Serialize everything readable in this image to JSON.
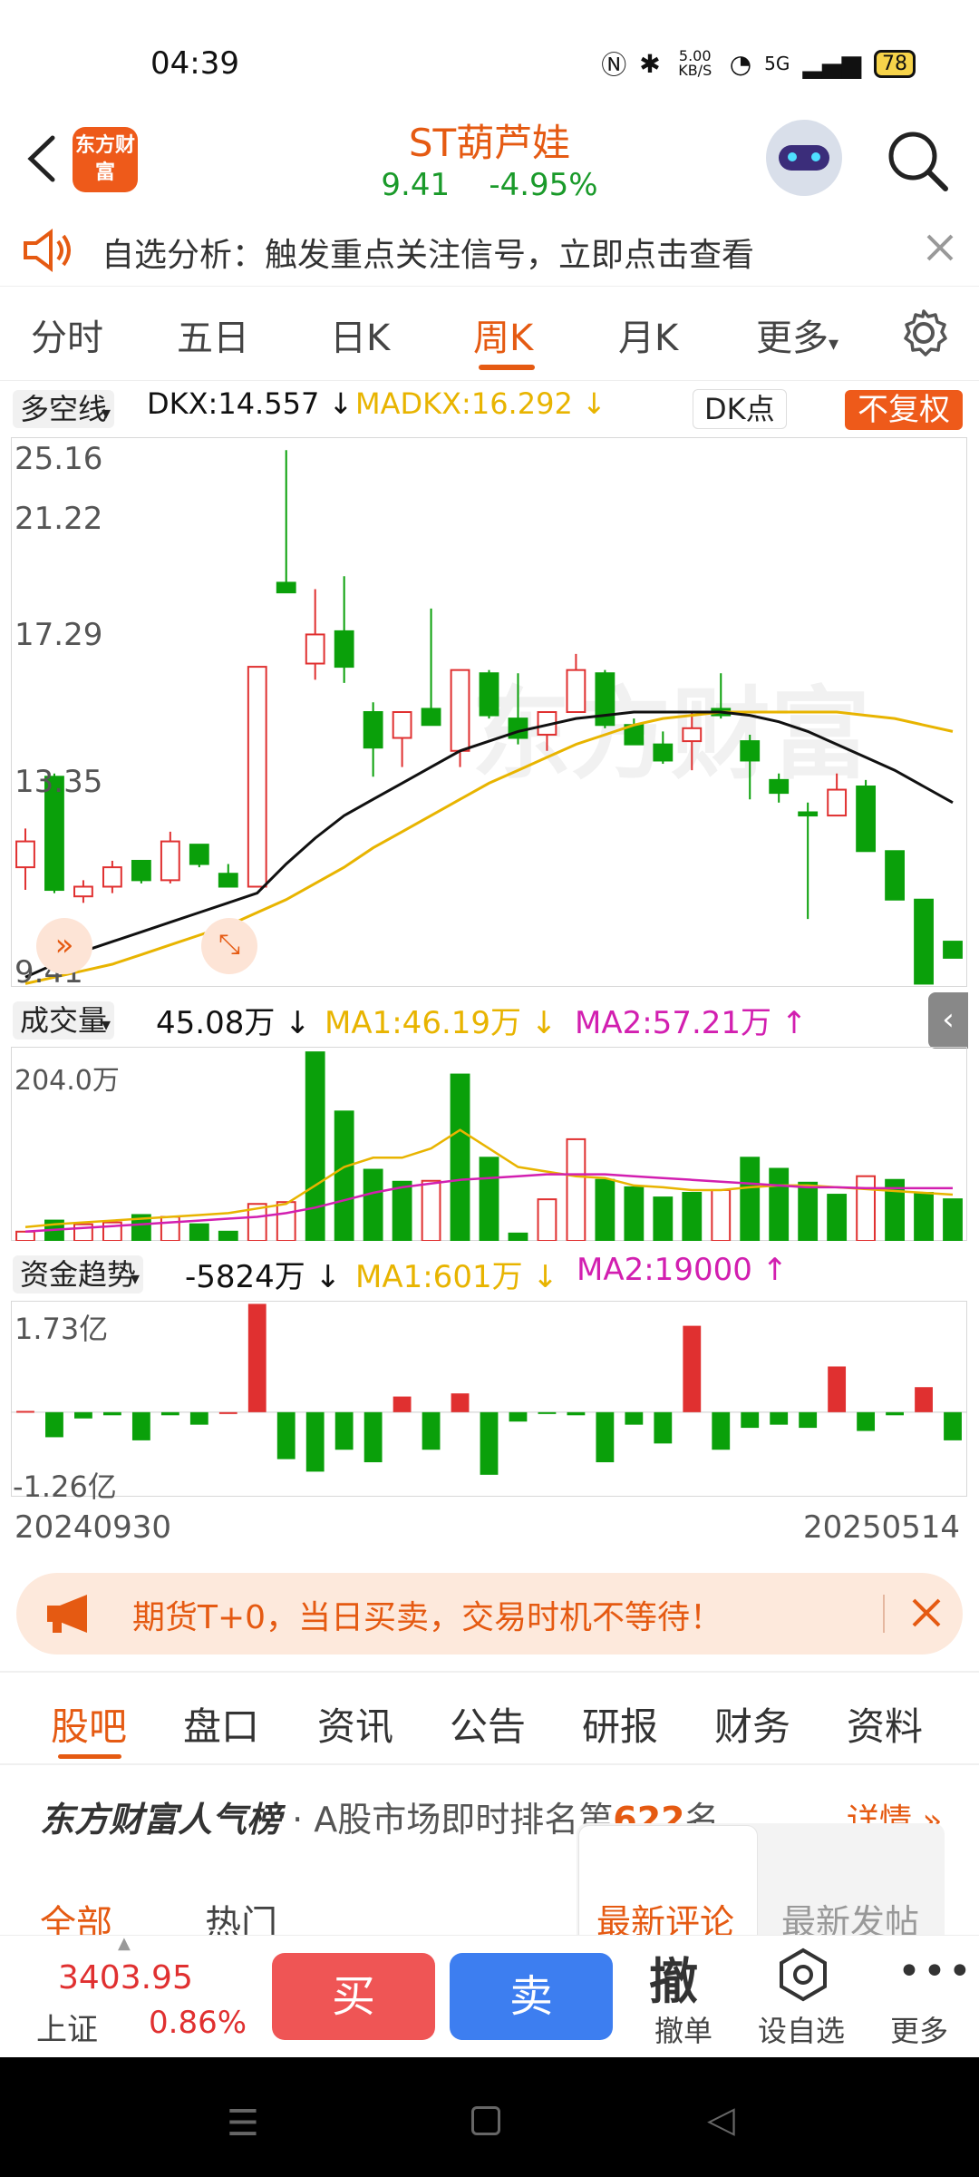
{
  "status_bar": {
    "time": "04:39",
    "net_speed": "5.00 KB/S",
    "signal": "5G",
    "battery": "78"
  },
  "header": {
    "logo": "东方财富",
    "title": "ST葫芦娃",
    "price": "9.41",
    "change": "-4.95%"
  },
  "notice": {
    "text": "自选分析：触发重点关注信号，立即点击查看"
  },
  "tabs": [
    "分时",
    "五日",
    "日K",
    "周K",
    "月K",
    "更多"
  ],
  "active_tab": "周K",
  "indicator": {
    "name": "多空线",
    "dkx": "DKX:14.557",
    "madkx": "MADKX:16.292",
    "dk_btn": "DK点",
    "adjust": "不复权"
  },
  "price_axis": [
    "25.16",
    "21.22",
    "17.29",
    "13.35",
    "9.41"
  ],
  "volume": {
    "name": "成交量",
    "value": "45.08万",
    "ma1": "MA1:46.19万",
    "ma2": "MA2:57.21万",
    "max": "204.0万"
  },
  "fund": {
    "name": "资金趋势",
    "value": "-5824万",
    "ma1": "MA1:601万",
    "ma2": "MA2:19000",
    "max": "1.73亿",
    "min": "-1.26亿"
  },
  "dates": {
    "start": "20240930",
    "end": "20250514"
  },
  "ad": {
    "text": "期货T+0，当日买卖，交易时机不等待！"
  },
  "bottom_tabs": [
    "股吧",
    "盘口",
    "资讯",
    "公告",
    "研报",
    "财务",
    "资料"
  ],
  "rank": {
    "brand": "东方财富人气榜",
    "text": "· A股市场即时排名第",
    "num": "622",
    "suffix": "名",
    "more": "详情"
  },
  "sub_tabs": {
    "all": "全部",
    "hot": "热门",
    "latest_comment": "最新评论",
    "latest_post": "最新发帖"
  },
  "index": {
    "value": "3403.95",
    "name": "上证",
    "change": "0.86%"
  },
  "actions": {
    "buy": "买",
    "sell": "卖",
    "cancel_icon": "撤",
    "cancel": "撤单",
    "watch": "设自选",
    "more": "更多"
  },
  "colors": {
    "up": "#e03030",
    "down": "#0aa00a",
    "accent": "#e55a12"
  },
  "chart_data": {
    "type": "candlestick",
    "weeks": 33,
    "candles": [
      [
        12.2,
        13.4,
        11.5,
        13.0
      ],
      [
        15.0,
        15.1,
        11.4,
        11.5
      ],
      [
        11.3,
        11.8,
        11.1,
        11.6
      ],
      [
        11.6,
        12.4,
        11.4,
        12.2
      ],
      [
        12.4,
        12.4,
        11.7,
        11.8
      ],
      [
        11.8,
        13.3,
        11.7,
        13.0
      ],
      [
        12.9,
        12.9,
        12.2,
        12.3
      ],
      [
        12.0,
        12.3,
        11.6,
        11.6
      ],
      [
        11.6,
        18.4,
        11.6,
        18.4
      ],
      [
        21.0,
        25.1,
        20.8,
        20.7
      ],
      [
        18.5,
        20.8,
        18.0,
        19.4
      ],
      [
        19.5,
        21.2,
        17.9,
        18.4
      ],
      [
        17.0,
        17.3,
        15.0,
        15.9
      ],
      [
        16.2,
        17.0,
        15.3,
        17.0
      ],
      [
        17.1,
        20.2,
        16.7,
        16.6
      ],
      [
        15.8,
        18.3,
        15.3,
        18.3
      ],
      [
        18.2,
        18.3,
        16.8,
        16.9
      ],
      [
        16.8,
        18.2,
        16.0,
        16.2
      ],
      [
        16.3,
        16.9,
        15.8,
        17.0
      ],
      [
        17.0,
        18.8,
        17.0,
        18.3
      ],
      [
        18.2,
        18.3,
        16.5,
        16.6
      ],
      [
        16.6,
        16.8,
        16.2,
        16.0
      ],
      [
        16.0,
        16.4,
        15.4,
        15.5
      ],
      [
        16.1,
        17.0,
        15.2,
        16.5
      ],
      [
        17.1,
        18.2,
        16.8,
        16.9
      ],
      [
        16.1,
        16.3,
        14.3,
        15.5
      ],
      [
        14.9,
        15.1,
        14.2,
        14.5
      ],
      [
        13.9,
        14.2,
        10.6,
        13.8
      ],
      [
        13.8,
        15.1,
        13.8,
        14.6
      ],
      [
        14.7,
        14.9,
        12.7,
        12.7
      ],
      [
        12.7,
        12.7,
        11.2,
        11.2
      ],
      [
        11.2,
        11.2,
        8.6,
        8.6
      ],
      [
        9.9,
        9.9,
        9.4,
        9.4
      ]
    ],
    "ma_black": [
      8.8,
      9.2,
      9.6,
      9.9,
      10.2,
      10.5,
      10.8,
      11.1,
      11.4,
      12.3,
      13.1,
      13.8,
      14.3,
      14.8,
      15.3,
      15.8,
      16.1,
      16.4,
      16.6,
      16.8,
      16.9,
      17.0,
      17.0,
      17.0,
      17.0,
      16.9,
      16.7,
      16.4,
      16.0,
      15.6,
      15.2,
      14.7,
      14.2
    ],
    "ma_yellow": [
      8.6,
      8.8,
      9.0,
      9.2,
      9.5,
      9.8,
      10.1,
      10.4,
      10.8,
      11.2,
      11.7,
      12.2,
      12.8,
      13.3,
      13.8,
      14.3,
      14.8,
      15.2,
      15.6,
      16.0,
      16.3,
      16.6,
      16.8,
      16.9,
      17.0,
      17.0,
      17.0,
      17.0,
      17.0,
      16.9,
      16.8,
      16.6,
      16.4
    ],
    "volume": [
      10,
      22,
      18,
      20,
      28,
      26,
      18,
      10,
      40,
      42,
      204,
      140,
      77,
      64,
      65,
      180,
      90,
      8,
      45,
      110,
      66,
      58,
      47,
      52,
      55,
      90,
      78,
      63,
      50,
      70,
      66,
      52,
      45
    ],
    "volume_up": [
      1,
      0,
      1,
      1,
      0,
      1,
      0,
      0,
      1,
      1,
      0,
      0,
      0,
      0,
      1,
      0,
      0,
      0,
      1,
      1,
      0,
      0,
      0,
      0,
      1,
      0,
      0,
      0,
      0,
      1,
      0,
      0,
      0
    ],
    "vol_ma1": [
      15,
      18,
      20,
      22,
      24,
      26,
      28,
      30,
      35,
      40,
      60,
      80,
      90,
      90,
      100,
      120,
      100,
      80,
      75,
      70,
      68,
      60,
      58,
      55,
      55,
      58,
      60,
      60,
      58,
      56,
      54,
      52,
      50
    ],
    "vol_ma2": [
      10,
      12,
      14,
      16,
      18,
      20,
      22,
      24,
      26,
      30,
      36,
      44,
      52,
      58,
      62,
      66,
      68,
      70,
      72,
      72,
      72,
      70,
      68,
      66,
      64,
      62,
      60,
      58,
      58,
      57,
      57,
      57,
      57
    ],
    "fund": [
      0.02,
      -0.4,
      -0.1,
      -0.05,
      -0.45,
      -0.05,
      -0.2,
      0.0,
      1.73,
      -0.75,
      -0.95,
      -0.6,
      -0.8,
      0.25,
      -0.6,
      0.3,
      -1.0,
      -0.15,
      -0.02,
      -0.05,
      -0.8,
      -0.2,
      -0.5,
      1.38,
      -0.6,
      -0.25,
      -0.2,
      -0.25,
      0.73,
      -0.3,
      -0.05,
      0.4,
      -0.45
    ]
  }
}
